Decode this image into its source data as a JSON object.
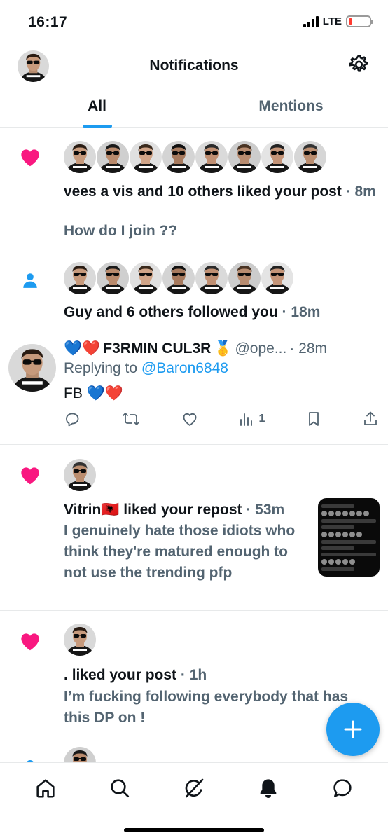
{
  "status_bar": {
    "time": "16:17",
    "network": "LTE"
  },
  "header": {
    "title": "Notifications"
  },
  "tabs": [
    {
      "label": "All",
      "active": true
    },
    {
      "label": "Mentions",
      "active": false
    }
  ],
  "notifications": [
    {
      "kind": "like",
      "icon": "heart-icon",
      "avatar_count": 8,
      "line1": "vees a vis and 10 others liked your post",
      "time": "· 8m",
      "snippet": "How do I join ??"
    },
    {
      "kind": "follow",
      "icon": "person-icon",
      "avatar_count": 7,
      "line1": "Guy and 6 others followed you",
      "time": "· 18m"
    },
    {
      "kind": "reply",
      "author_emojis": "💙❤️",
      "author_name": "F3RMIN CUL3R",
      "author_badge": "🥇",
      "handle": "@ope...",
      "time": "· 28m",
      "replying_prefix": "Replying to",
      "replying_handle": "@Baron6848",
      "body": "FB 💙❤️",
      "views": "1"
    },
    {
      "kind": "like",
      "icon": "heart-icon",
      "user": "Vitrin🇦🇱",
      "action": "liked your repost",
      "time": "· 53m",
      "snippet": "I genuinely hate those idiots who think they're matured enough to not use the trending pfp"
    },
    {
      "kind": "like",
      "icon": "heart-icon",
      "user": ".",
      "action": "liked your post",
      "time": "· 1h",
      "snippet": "I’m fucking following everybody that has this DP on !"
    },
    {
      "kind": "partial",
      "icon": "dot-icon"
    }
  ],
  "colors": {
    "accent": "#1d9bf0",
    "like": "#f91880",
    "text": "#0f1419",
    "muted": "#536471",
    "battery_low": "#ff3b30"
  },
  "bottom_nav": [
    {
      "name": "home",
      "icon": "home-icon"
    },
    {
      "name": "search",
      "icon": "search-icon"
    },
    {
      "name": "grok",
      "icon": "grok-icon"
    },
    {
      "name": "notifications",
      "icon": "bell-icon",
      "active": true
    },
    {
      "name": "messages",
      "icon": "message-icon"
    }
  ]
}
